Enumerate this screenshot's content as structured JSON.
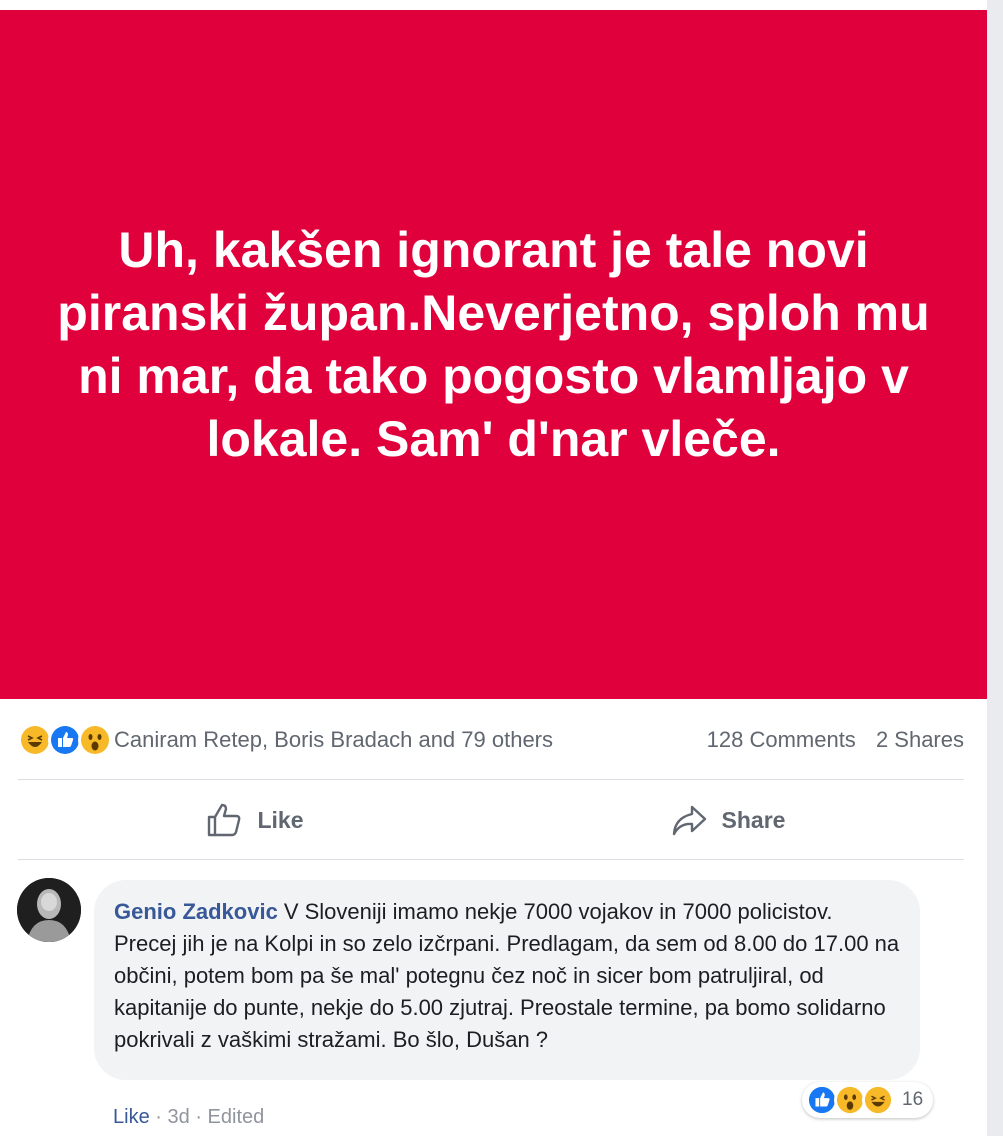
{
  "post": {
    "text": "Uh, kakšen ignorant je tale novi piranski župan.Neverjetno, sploh mu ni mar, da tako pogosto vlamljajo v lokale. Sam' d'nar vleče.",
    "background_color": "#e0003c"
  },
  "reactions": {
    "icons": [
      "haha-icon",
      "like-icon",
      "wow-icon"
    ],
    "summary": "Caniram Retep, Boris Bradach and 79 others",
    "comments": "128 Comments",
    "shares": "2 Shares"
  },
  "actions": {
    "like_label": "Like",
    "share_label": "Share"
  },
  "comment": {
    "author": "Genio Zadkovic",
    "text": "V Sloveniji imamo nekje 7000 vojakov in 7000 policistov. Precej jih je na Kolpi in so zelo izčrpani. Predlagam, da sem od 8.00 do 17.00 na občini, potem bom pa še mal' potegnu čez noč in sicer bom patruljiral, od kapitanije do punte, nekje do 5.00 zjutraj. Preostale termine, pa bomo solidarno pokrivali z vaškimi stražami. Bo šlo, Dušan ?",
    "like_label": "Like",
    "time": "3d",
    "edited": "Edited",
    "separator": "·",
    "reaction_icons": [
      "like-icon",
      "wow-icon",
      "haha-icon"
    ],
    "reaction_count": "16"
  },
  "colors": {
    "accent": "#385898",
    "like_blue": "#1877f2",
    "emoji_yellow": "#f7b928"
  }
}
